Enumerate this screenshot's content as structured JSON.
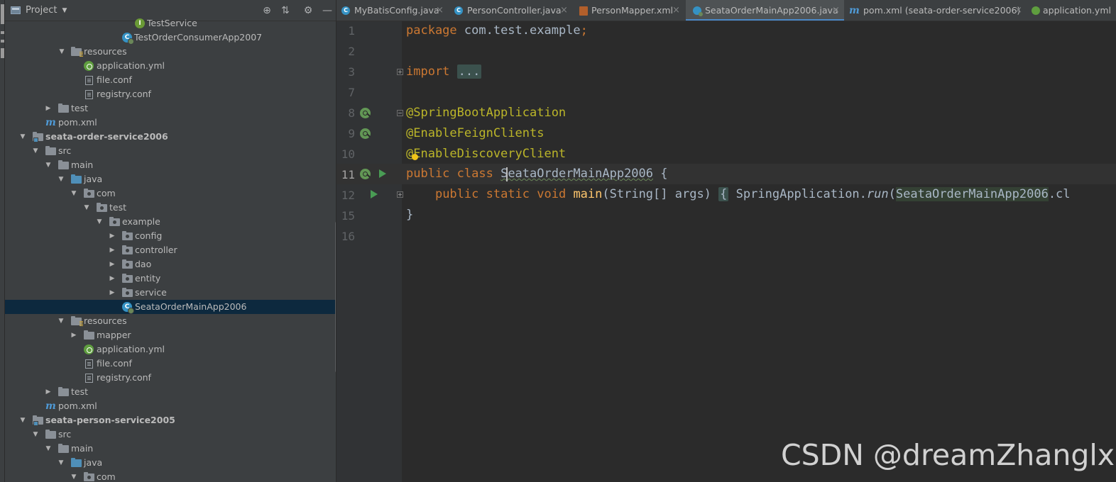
{
  "project_panel": {
    "title": "Project",
    "tree": [
      {
        "label": "TestService",
        "icon": "interface-icon",
        "arrow": ""
      },
      {
        "label": "TestOrderConsumerApp2007",
        "icon": "spring-class-icon",
        "arrow": ""
      },
      {
        "label": "resources",
        "icon": "resources-folder-icon",
        "arrow": "▼"
      },
      {
        "label": "application.yml",
        "icon": "yaml-file-icon",
        "arrow": ""
      },
      {
        "label": "file.conf",
        "icon": "text-file-icon",
        "arrow": ""
      },
      {
        "label": "registry.conf",
        "icon": "text-file-icon",
        "arrow": ""
      },
      {
        "label": "test",
        "icon": "folder-icon",
        "arrow": "▶"
      },
      {
        "label": "pom.xml",
        "icon": "maven-file-icon",
        "arrow": ""
      },
      {
        "label": "seata-order-service2006",
        "icon": "module-folder-icon",
        "arrow": "▼"
      },
      {
        "label": "src",
        "icon": "folder-icon",
        "arrow": "▼"
      },
      {
        "label": "main",
        "icon": "folder-icon",
        "arrow": "▼"
      },
      {
        "label": "java",
        "icon": "source-folder-icon",
        "arrow": "▼"
      },
      {
        "label": "com",
        "icon": "package-icon",
        "arrow": "▼"
      },
      {
        "label": "test",
        "icon": "package-icon",
        "arrow": "▼"
      },
      {
        "label": "example",
        "icon": "package-icon",
        "arrow": "▼"
      },
      {
        "label": "config",
        "icon": "package-icon",
        "arrow": "▶"
      },
      {
        "label": "controller",
        "icon": "package-icon",
        "arrow": "▶"
      },
      {
        "label": "dao",
        "icon": "package-icon",
        "arrow": "▶"
      },
      {
        "label": "entity",
        "icon": "package-icon",
        "arrow": "▶"
      },
      {
        "label": "service",
        "icon": "package-icon",
        "arrow": "▶"
      },
      {
        "label": "SeataOrderMainApp2006",
        "icon": "spring-class-icon",
        "arrow": ""
      },
      {
        "label": "resources",
        "icon": "resources-folder-icon",
        "arrow": "▼"
      },
      {
        "label": "mapper",
        "icon": "folder-icon",
        "arrow": "▶"
      },
      {
        "label": "application.yml",
        "icon": "yaml-file-icon",
        "arrow": ""
      },
      {
        "label": "file.conf",
        "icon": "text-file-icon",
        "arrow": ""
      },
      {
        "label": "registry.conf",
        "icon": "text-file-icon",
        "arrow": ""
      },
      {
        "label": "test",
        "icon": "folder-icon",
        "arrow": "▶"
      },
      {
        "label": "pom.xml",
        "icon": "maven-file-icon",
        "arrow": ""
      },
      {
        "label": "seata-person-service2005",
        "icon": "module-folder-icon",
        "arrow": "▼"
      },
      {
        "label": "src",
        "icon": "folder-icon",
        "arrow": "▼"
      },
      {
        "label": "main",
        "icon": "folder-icon",
        "arrow": "▼"
      },
      {
        "label": "java",
        "icon": "source-folder-icon",
        "arrow": "▼"
      },
      {
        "label": "com",
        "icon": "package-icon",
        "arrow": "▼"
      }
    ],
    "selected_item": "SeataOrderMainApp2006"
  },
  "tabs": [
    {
      "label": "MyBatisConfig.java",
      "icon": "class-icon"
    },
    {
      "label": "PersonController.java",
      "icon": "class-icon"
    },
    {
      "label": "PersonMapper.xml",
      "icon": "xml-file-icon"
    },
    {
      "label": "SeataOrderMainApp2006.java",
      "icon": "spring-class-icon",
      "active": true
    },
    {
      "label": "pom.xml (seata-order-service2006)",
      "icon": "maven-file-icon"
    },
    {
      "label": "application.yml",
      "icon": "yaml-file-icon"
    }
  ],
  "editor": {
    "line_numbers": [
      "1",
      "2",
      "3",
      "7",
      "8",
      "9",
      "10",
      "11",
      "12",
      "15",
      "16"
    ],
    "code": {
      "l1_kw": "package",
      "l1_rest": " com.test.example",
      "l1_semi": ";",
      "l3_kw": "import",
      "l3_fold": "...",
      "l8": "@SpringBootApplication",
      "l9": "@EnableFeignClients",
      "l10": "@EnableDiscoveryClient",
      "l11_kw": "public class",
      "l11_name": "SeataOrderMainApp2006",
      "l11_brace": " {",
      "l12_indent": "    ",
      "l12_kw": "public static void",
      "l12_fn": "main",
      "l12_params": "(String[] args)",
      "l12_fold": "{",
      "l12_cls": "SpringApplication.",
      "l12_run": "run",
      "l12_paren": "(",
      "l12_arg": "SeataOrderMainApp2006",
      "l12_tail": ".cl",
      "l15": "}"
    }
  },
  "watermark": "CSDN @dreamZhanglx"
}
